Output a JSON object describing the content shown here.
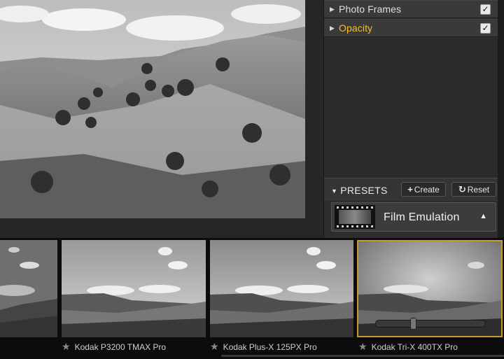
{
  "layers": [
    {
      "label": "Photo Frames",
      "checked": true,
      "active": false
    },
    {
      "label": "Opacity",
      "checked": true,
      "active": true
    }
  ],
  "presets": {
    "title": "PRESETS",
    "create_label": "Create",
    "reset_label": "Reset",
    "selected": "Film Emulation"
  },
  "filmstrip": [
    {
      "caption": "",
      "selected": false
    },
    {
      "caption": "Kodak P3200 TMAX Pro",
      "selected": false
    },
    {
      "caption": "Kodak Plus-X 125PX Pro",
      "selected": false
    },
    {
      "caption": "Kodak Tri-X 400TX Pro",
      "selected": true
    }
  ],
  "colors": {
    "accent": "#f0c030",
    "selection": "#c79a2a"
  }
}
